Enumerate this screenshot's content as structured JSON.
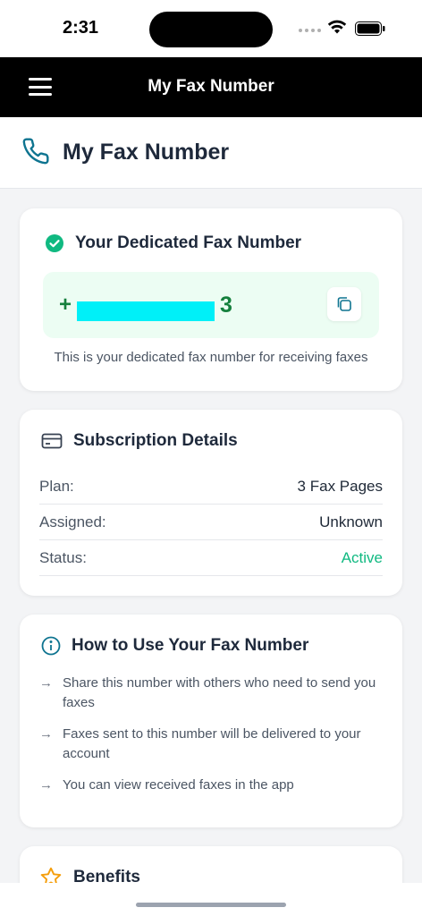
{
  "status_bar": {
    "time": "2:31"
  },
  "app_bar": {
    "title": "My Fax Number"
  },
  "page_header": {
    "title": "My Fax Number"
  },
  "fax_card": {
    "title": "Your Dedicated Fax Number",
    "number_prefix": "+",
    "number_suffix": "3",
    "caption": "This is your dedicated fax number for receiving faxes"
  },
  "subscription": {
    "title": "Subscription Details",
    "rows": [
      {
        "label": "Plan:",
        "value": "3 Fax Pages"
      },
      {
        "label": "Assigned:",
        "value": "Unknown"
      },
      {
        "label": "Status:",
        "value": "Active"
      }
    ]
  },
  "how_to": {
    "title": "How to Use Your Fax Number",
    "items": [
      "Share this number with others who need to send you faxes",
      "Faxes sent to this number will be delivered to your account",
      "You can view received faxes in the app"
    ]
  },
  "benefits": {
    "title": "Benefits"
  },
  "colors": {
    "accent_green": "#10b981",
    "number_green": "#15803d",
    "icon_teal": "#0e7490",
    "star_orange": "#f59e0b",
    "redaction": "#00f0f8"
  },
  "icons": {
    "menu": "menu-icon",
    "phone": "phone-icon",
    "check": "check-circle-icon",
    "copy": "copy-icon",
    "card": "credit-card-icon",
    "info": "info-icon",
    "arrow": "arrow-right-icon",
    "star": "star-icon"
  }
}
